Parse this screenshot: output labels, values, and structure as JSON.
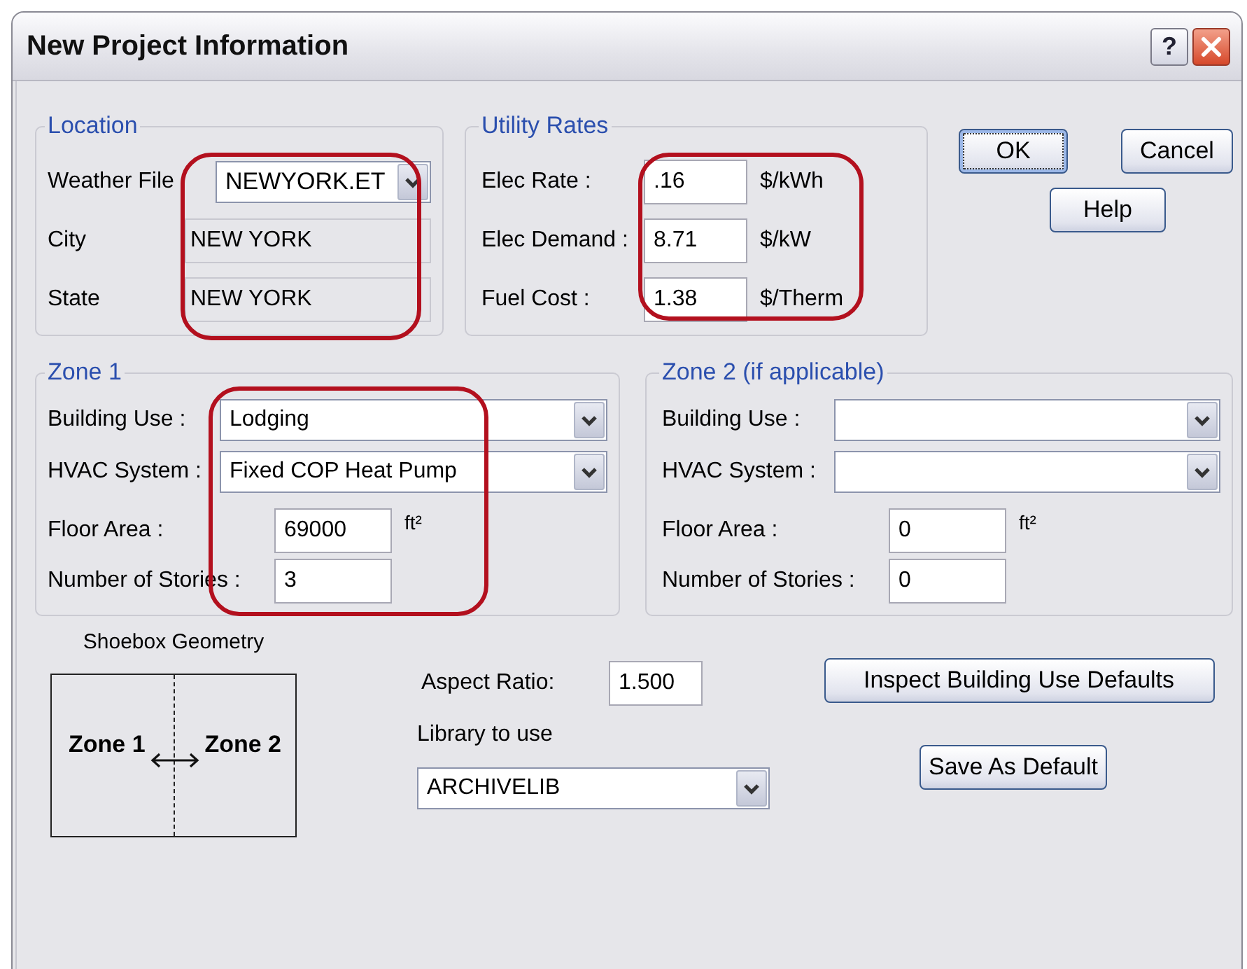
{
  "window": {
    "title": "New Project Information",
    "help_button": "?"
  },
  "location": {
    "title": "Location",
    "highlighted": true,
    "weather_file": {
      "label": "Weather File",
      "value": "NEWYORK.ET"
    },
    "city": {
      "label": "City",
      "value": "NEW YORK"
    },
    "state": {
      "label": "State",
      "value": "NEW YORK"
    }
  },
  "utility_rates": {
    "title": "Utility Rates",
    "highlighted": true,
    "rows": [
      {
        "label": "Elec Rate :",
        "value": ".16",
        "unit": "$/kWh"
      },
      {
        "label": "Elec Demand :",
        "value": "8.71",
        "unit": "$/kW"
      },
      {
        "label": "Fuel Cost :",
        "value": "1.38",
        "unit": "$/Therm"
      }
    ]
  },
  "dialog_buttons": [
    {
      "label": "OK",
      "focused": true
    },
    {
      "label": "Cancel",
      "focused": false
    },
    {
      "label": "Help",
      "focused": false
    }
  ],
  "zones": [
    {
      "title": "Zone 1",
      "highlighted": true,
      "building_use": {
        "label": "Building Use :",
        "value": "Lodging"
      },
      "hvac_system": {
        "label": "HVAC System :",
        "value": "Fixed COP Heat Pump"
      },
      "floor_area": {
        "label": "Floor Area :",
        "value": "69000",
        "unit": "ft²"
      },
      "stories": {
        "label": "Number of Stories :",
        "value": "3"
      }
    },
    {
      "title": "Zone 2 (if applicable)",
      "highlighted": false,
      "building_use": {
        "label": "Building Use :"
      },
      "hvac_system": {
        "label": "HVAC System :"
      },
      "floor_area": {
        "label": "Floor Area :",
        "value": "0",
        "unit": "ft²"
      },
      "stories": {
        "label": "Number of Stories :",
        "value": "0"
      }
    }
  ],
  "shoebox": {
    "title": "Shoebox Geometry",
    "left_label": "Zone 1",
    "right_label": "Zone 2"
  },
  "aspect_ratio": {
    "label": "Aspect Ratio:",
    "value": "1.500"
  },
  "library": {
    "label": "Library to use",
    "value": "ARCHIVELIB"
  },
  "actions": [
    "Inspect Building Use Defaults",
    "Save As Default"
  ]
}
